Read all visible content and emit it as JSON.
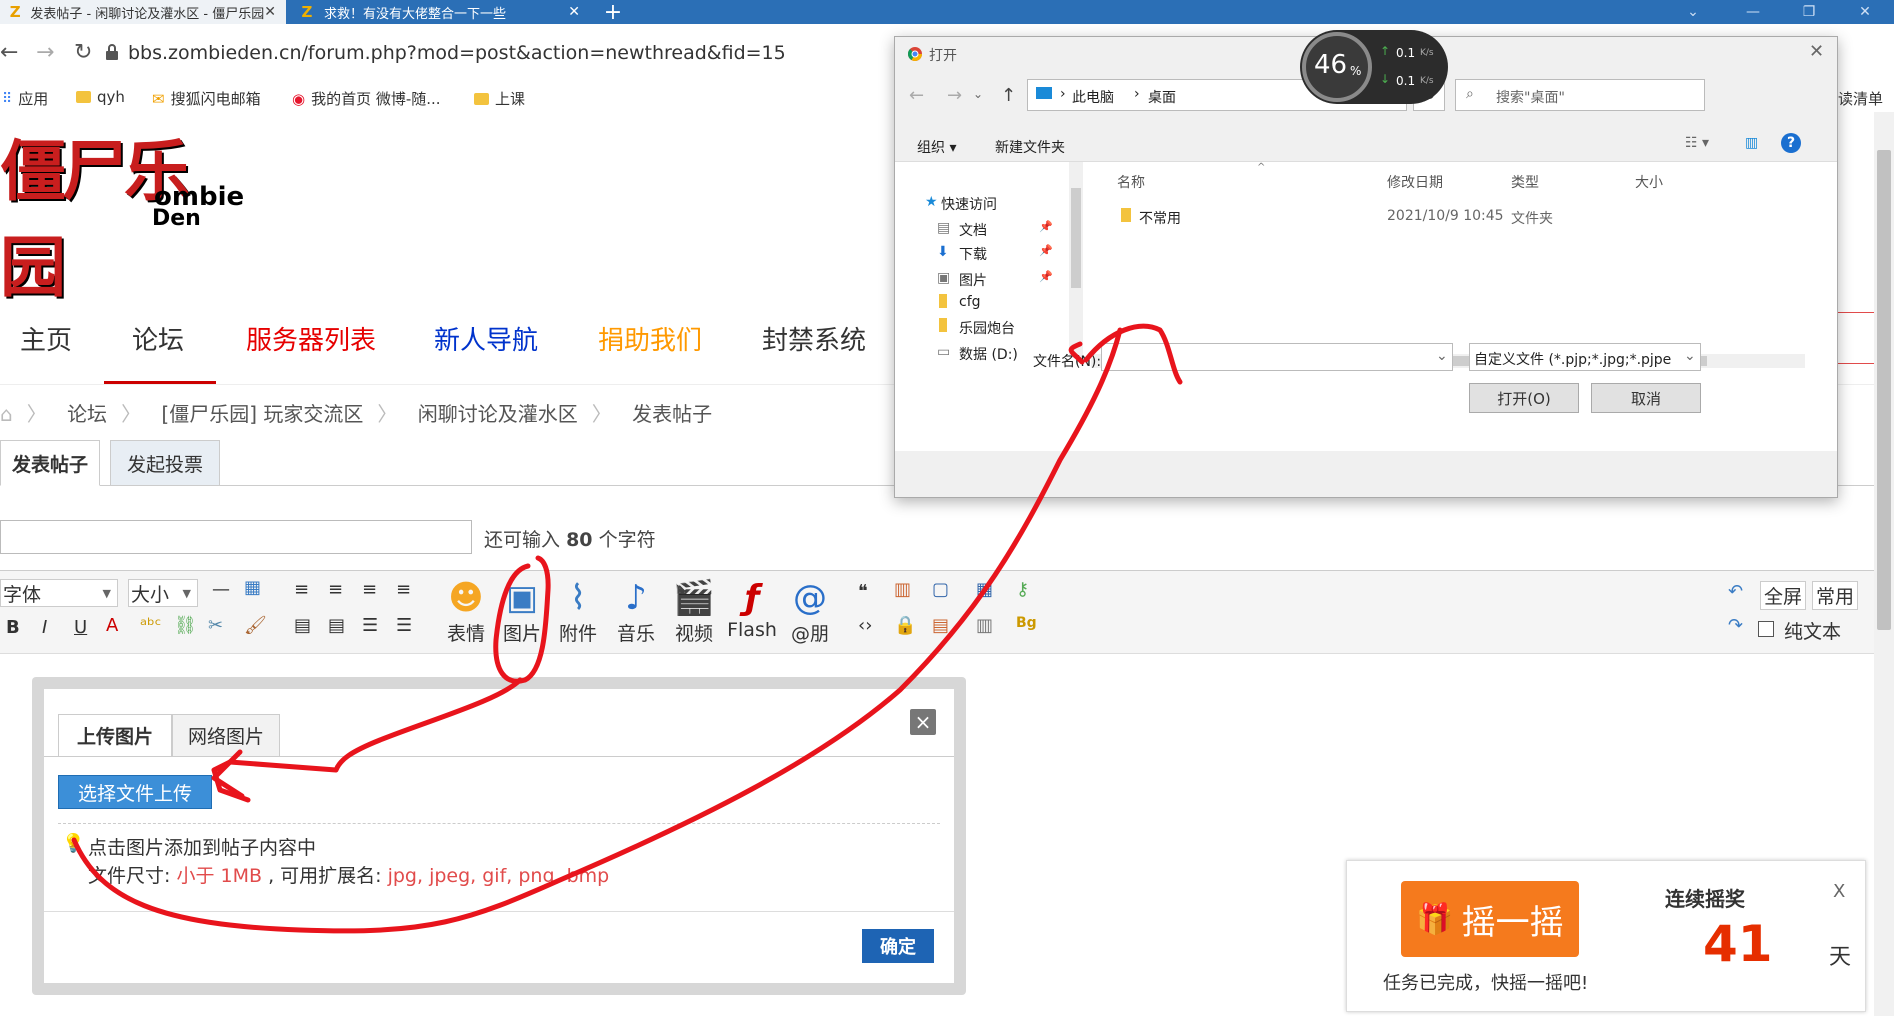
{
  "tabs": [
    {
      "title": "发表帖子 - 闲聊讨论及灌水区 - 僵尸乐园",
      "icon": "z-logo-icon"
    },
    {
      "title": "求救！有没有大佬整合一下一些",
      "icon": "z-logo-icon"
    }
  ],
  "address": {
    "url": "bbs.zombieden.cn/forum.php?mod=post&action=newthread&fid=15"
  },
  "bookmarks": [
    "应用",
    "qyh",
    "搜狐闪电邮箱",
    "我的首页 微博-随...",
    "上课"
  ],
  "right_bookmark": "读清单",
  "logo": {
    "cn": "僵尸乐园",
    "en1": "ombie",
    "en2": "Den"
  },
  "nav": [
    {
      "label": "主页",
      "color": "#333333"
    },
    {
      "label": "论坛",
      "color": "#333333"
    },
    {
      "label": "服务器列表",
      "color": "#e60000"
    },
    {
      "label": "新人导航",
      "color": "#0033cc"
    },
    {
      "label": "捐助我们",
      "color": "#ff9900"
    },
    {
      "label": "封禁系统",
      "color": "#333333"
    }
  ],
  "breadcrumb": [
    "论坛",
    "[僵尸乐园] 玩家交流区",
    "闲聊讨论及灌水区",
    "发表帖子"
  ],
  "post_tabs": [
    "发表帖子",
    "发起投票"
  ],
  "title_hint": {
    "pre": "还可输入",
    "num": "80",
    "post": "个字符"
  },
  "toolbar": {
    "font": "字体",
    "size": "大小",
    "tools": [
      "表情",
      "图片",
      "附件",
      "音乐",
      "视频",
      "Flash",
      "@朋"
    ],
    "fullscreen": "全屏",
    "common": "常用",
    "plaintext": "纯文本"
  },
  "upload": {
    "tabs": [
      "上传图片",
      "网络图片"
    ],
    "choose": "选择文件上传",
    "hint": "点击图片添加到帖子内容中",
    "size_label": "文件尺寸:",
    "size_val": "小于 1MB",
    "ext_label": ", 可用扩展名:",
    "ext_val": "jpg, jpeg, gif, png, bmp",
    "ok": "确定",
    "close": "×"
  },
  "shake": {
    "button": "摇一摇",
    "done": "任务已完成，快摇一摇吧!",
    "title": "连续摇奖",
    "days": "41",
    "unit": "天",
    "close": "X"
  },
  "netmon": {
    "percent": "46",
    "unit": "%",
    "up": "0.1",
    "down": "0.1",
    "rate": "K/s"
  },
  "file_dialog": {
    "title": "打开",
    "path": [
      "此电脑",
      "桌面"
    ],
    "search": "搜索\"桌面\"",
    "organize": "组织 ▾",
    "new_folder": "新建文件夹",
    "columns": [
      "名称",
      "修改日期",
      "类型",
      "大小"
    ],
    "files": [
      {
        "name": "不常用",
        "date": "2021/10/9 10:45",
        "type": "文件夹"
      }
    ],
    "quick_access": "快速访问",
    "tree": [
      "文档",
      "下载",
      "图片",
      "cfg",
      "乐园炮台",
      "数据 (D:)"
    ],
    "filename_label": "文件名(N):",
    "filetype": "自定义文件 (*.pjp;*.jpg;*.pjpe",
    "open": "打开(O)",
    "cancel": "取消"
  }
}
